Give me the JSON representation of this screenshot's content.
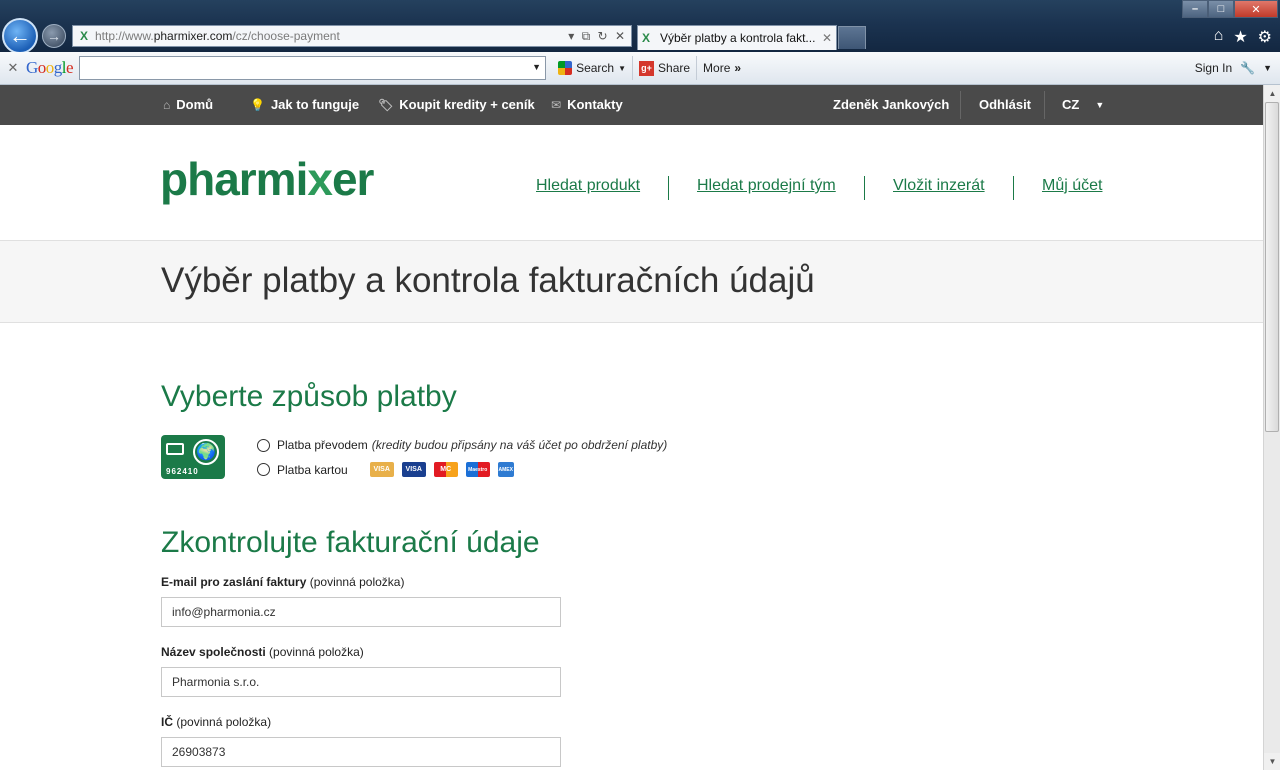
{
  "browser": {
    "url_prefix": "http://www.",
    "url_domain": "pharmixer.com",
    "url_path": "/cz/choose-payment",
    "tab_title": "Výběr platby a kontrola fakt...",
    "toolbar": {
      "search_label": "Search",
      "share_label": "Share",
      "more_label": "More",
      "signin_label": "Sign In"
    }
  },
  "sitebar": {
    "home": "Domů",
    "how": "Jak to funguje",
    "buy": "Koupit kredity + ceník",
    "contacts": "Kontakty",
    "user": "Zdeněk Jankových",
    "logout": "Odhlásit",
    "lang": "CZ"
  },
  "header": {
    "logo_text_a": "pharmi",
    "logo_text_b": "x",
    "logo_text_c": "er",
    "nav": {
      "search_product": "Hledat produkt",
      "search_team": "Hledat prodejní tým",
      "post_ad": "Vložit inzerát",
      "my_account": "Můj účet"
    }
  },
  "page_title": "Výběr platby a kontrola fakturačních údajů",
  "payment": {
    "heading": "Vyberte způsob platby",
    "icon_number": "962410",
    "transfer_label": "Platba převodem",
    "transfer_note": "(kredity budou připsány na váš účet po obdržení platby)",
    "card_label": "Platba kartou",
    "cards": [
      "VISA",
      "VISA",
      "MC",
      "Maestro",
      "AMEX"
    ]
  },
  "billing": {
    "heading": "Zkontrolujte fakturační údaje",
    "required_note": "(povinná položka)",
    "email_label": "E-mail pro zaslání faktury",
    "email_value": "info@pharmonia.cz",
    "company_label": "Název společnosti",
    "company_value": "Pharmonia s.r.o.",
    "ic_label": "IČ",
    "ic_value": "26903873"
  },
  "colors": {
    "brand_green": "#1b7a48",
    "topbar": "#4a4a4a"
  }
}
